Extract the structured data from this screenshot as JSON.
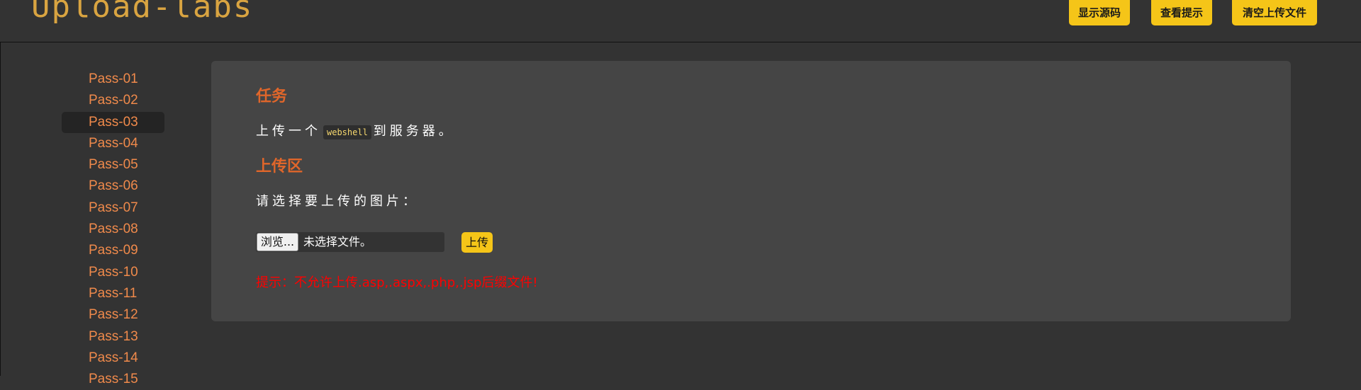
{
  "header": {
    "logo_text": "Upload-labs",
    "buttons": [
      {
        "label": "显示源码"
      },
      {
        "label": "查看提示"
      },
      {
        "label": "清空上传文件"
      }
    ]
  },
  "sidebar": {
    "items": [
      {
        "label": "Pass-01"
      },
      {
        "label": "Pass-02"
      },
      {
        "label": "Pass-03"
      },
      {
        "label": "Pass-04"
      },
      {
        "label": "Pass-05"
      },
      {
        "label": "Pass-06"
      },
      {
        "label": "Pass-07"
      },
      {
        "label": "Pass-08"
      },
      {
        "label": "Pass-09"
      },
      {
        "label": "Pass-10"
      },
      {
        "label": "Pass-11"
      },
      {
        "label": "Pass-12"
      },
      {
        "label": "Pass-13"
      },
      {
        "label": "Pass-14"
      },
      {
        "label": "Pass-15"
      }
    ],
    "active_index": 2
  },
  "main": {
    "task_heading": "任务",
    "task_text_before": "上传一个",
    "task_code": "webshell",
    "task_text_after": "到服务器。",
    "upload_heading": "上传区",
    "select_prompt": "请选择要上传的图片：",
    "browse_label": "浏览...",
    "file_status": "未选择文件。",
    "submit_label": "上传",
    "hint": "提示：不允许上传.asp,.aspx,.php,.jsp后缀文件!"
  },
  "colors": {
    "accent_yellow": "#f5c518",
    "heading_orange": "#e0662a",
    "nav_orange": "#f08a4b",
    "hint_red": "#ff0000"
  }
}
